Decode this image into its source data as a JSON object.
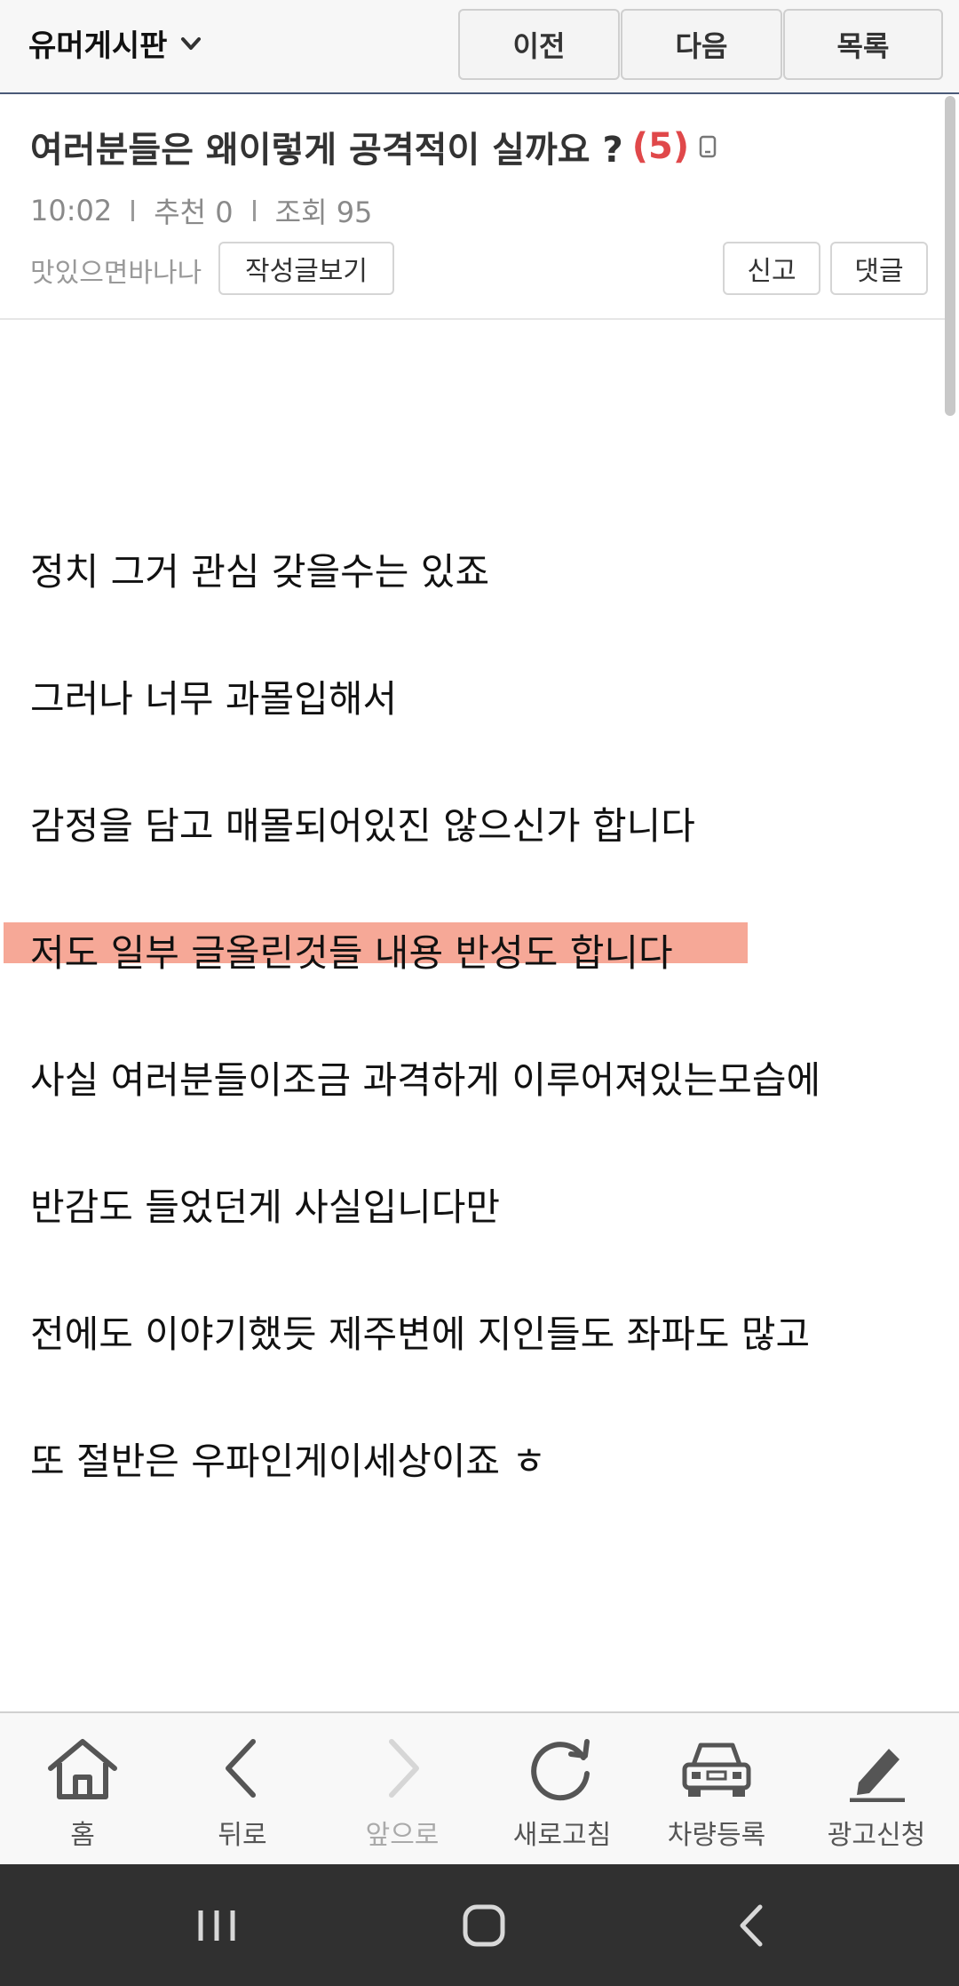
{
  "topbar": {
    "board_name": "유머게시판",
    "prev_label": "이전",
    "next_label": "다음",
    "list_label": "목록"
  },
  "post": {
    "title": "여러분들은 왜이렇게 공격적이 실까요 ?",
    "comment_count": "(5)",
    "time": "10:02",
    "recommend": "추천 0",
    "views": "조회 95",
    "author": "맛있으면바나나",
    "author_posts_label": "작성글보기",
    "report_label": "신고",
    "comment_label": "댓글",
    "lines": [
      "정치 그거 관심 갖을수는 있죠",
      "그러나 너무 과몰입해서",
      "감정을 담고  매몰되어있진 않으신가 합니다",
      "저도 일부 글올린것들 내용 반성도 합니다",
      "사실 여러분들이조금 과격하게 이루어져있는모습에",
      "반감도 들었던게 사실입니다만",
      "전에도 이야기했듯 제주변에 지인들도 좌파도 많고",
      "또 절반은 우파인게이세상이죠 ㅎ"
    ]
  },
  "toolbar": {
    "home": "홈",
    "back": "뒤로",
    "forward": "앞으로",
    "refresh": "새로고침",
    "car_register": "차량등록",
    "ad_apply": "광고신청"
  },
  "colors": {
    "accent_red": "#e0484a",
    "highlight": "#f6a897",
    "topbar_border": "#4a5a78"
  },
  "icons": [
    "chevron-down-icon",
    "mobile-icon",
    "home-icon",
    "back-icon",
    "forward-icon",
    "refresh-icon",
    "car-icon",
    "pencil-icon",
    "recent-apps-icon",
    "home-circle-icon",
    "system-back-icon"
  ]
}
